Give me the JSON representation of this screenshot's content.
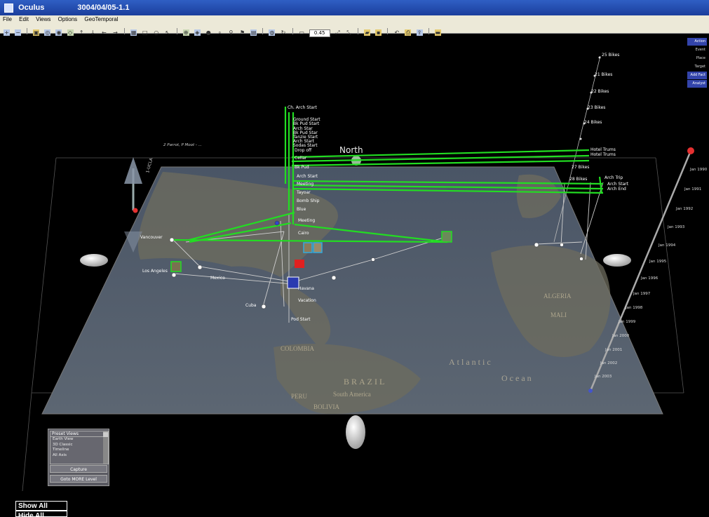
{
  "window": {
    "app_name": "Oculus",
    "title": "3004/04/05-1.1"
  },
  "menu": [
    "File",
    "Edit",
    "Views",
    "Options",
    "GeoTemporal"
  ],
  "toolbar": {
    "zoom_field": "0.45"
  },
  "mode_buttons": [
    {
      "label": "Action",
      "active": true
    },
    {
      "label": "Event",
      "active": false
    },
    {
      "label": "Place",
      "active": false
    },
    {
      "label": "Target",
      "active": false
    },
    {
      "label": "Add Fact",
      "active": true
    },
    {
      "label": "Analyst",
      "active": true
    }
  ],
  "scene": {
    "north_label": "North",
    "top_label": "2 Parrot, P Moot - ...",
    "vertical_axis_label": "1-UCLA",
    "timeline_left": {
      "labels": [
        "Ch. Arch Start",
        "Ground Start",
        "Bk Pud Start",
        "Arch Star",
        "Bk Pud Star",
        "Tanzie Start",
        "Arch Start",
        "Sodas Start",
        "Drop off",
        "Cellar",
        "Bk Pud",
        "Arch Start",
        "Meeting",
        "Tayoar",
        "Bomb Ship",
        "Blue",
        "Meeting",
        "Cairo",
        "Vacation",
        "Pod Start"
      ]
    },
    "timeline_right": {
      "labels": [
        "25 Bikes",
        "21 Bikes",
        "22 Bikes",
        "23 Bikes",
        "24 Bikes",
        "Hotel Trums",
        "Hotel Trums",
        "27 Bikes",
        "Arch Trip",
        "Arch Start",
        "Arch End",
        "28 Bikes"
      ]
    },
    "time_axis": {
      "labels": [
        "Jan 1990",
        "Jan 1991",
        "Jan 1992",
        "Jan 1993",
        "Jan 1994",
        "Jan 1995",
        "Jan 1996",
        "Jan 1997",
        "Jan 1998",
        "Jan 1999",
        "Jan 2000",
        "Jan 2001",
        "Jan 2002",
        "Jan 2003"
      ]
    },
    "map_labels": {
      "atlantic": "Atlantic",
      "ocean": "Ocean",
      "brazil": "BRAZIL",
      "south_america": "South America",
      "peru": "PERU",
      "bolivia": "BOLIVIA",
      "colombia": "COLOMBIA",
      "mali": "MALI",
      "algeria": "ALGERIA"
    },
    "place_labels": {
      "los_angeles": "Los Angeles",
      "vancouver": "Vancouver",
      "havana": "Havana",
      "cuba": "Cuba",
      "mexico": "Mexico"
    },
    "colors": {
      "thread": "#22dd22",
      "link": "#cfcfcf",
      "time_axis_knob": "#e53030",
      "map_water": "#3b4a60"
    }
  },
  "preset_panel": {
    "header": "Preset Views",
    "items": [
      "Earth View",
      "3D Classic",
      "Timeline",
      "All Axis"
    ],
    "capture_label": "Capture",
    "load_label": "Goto MORE Level"
  },
  "show_all_label": "Show All",
  "hide_all_label": "Hide All"
}
